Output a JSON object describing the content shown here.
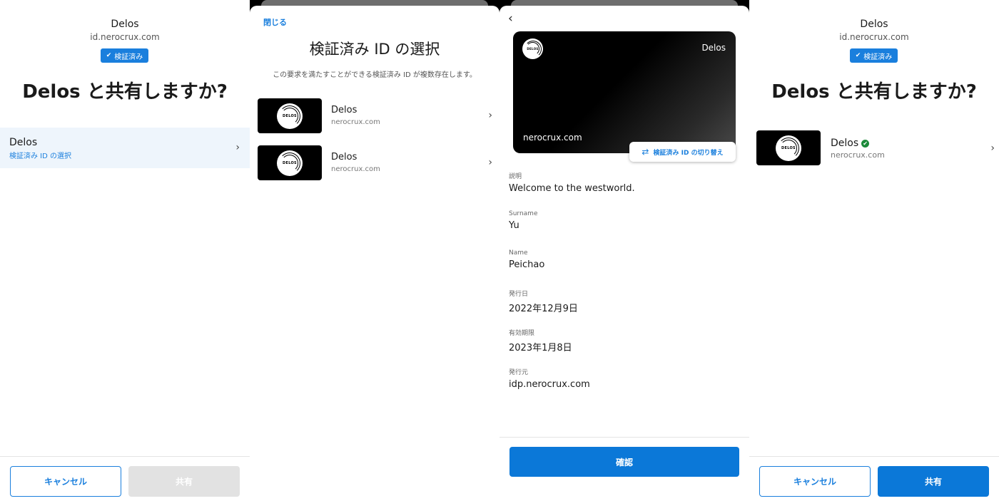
{
  "share_screen_1": {
    "rp_name": "Delos",
    "rp_domain": "id.nerocrux.com",
    "verified_badge": "検証済み",
    "title": "Delos と共有しますか?",
    "select_row": {
      "title": "Delos",
      "subtitle": "検証済み ID の選択"
    },
    "cancel_label": "キャンセル",
    "share_label": "共有",
    "share_enabled": false
  },
  "select_sheet": {
    "close_label": "閉じる",
    "title": "検証済み ID の選択",
    "subtitle": "この要求を満たすことができる検証済み ID が複数存在します。",
    "items": [
      {
        "name": "Delos",
        "domain": "nerocrux.com",
        "logo_text": "DELOS"
      },
      {
        "name": "Delos",
        "domain": "nerocrux.com",
        "logo_text": "DELOS"
      }
    ]
  },
  "detail_screen": {
    "card": {
      "name": "Delos",
      "domain": "nerocrux.com",
      "logo_text": "DELOS"
    },
    "switch_label": "検証済み ID の切り替え",
    "fields": [
      {
        "label": "説明",
        "value": "Welcome to the westworld."
      },
      {
        "label": "Surname",
        "value": "Yu"
      },
      {
        "label": "Name",
        "value": "Peichao"
      },
      {
        "label": "発行日",
        "value": "2022年12月9日"
      },
      {
        "label": "有効期限",
        "value": "2023年1月8日"
      },
      {
        "label": "発行元",
        "value": "idp.nerocrux.com"
      }
    ],
    "confirm_label": "確認"
  },
  "share_screen_2": {
    "rp_name": "Delos",
    "rp_domain": "id.nerocrux.com",
    "verified_badge": "検証済み",
    "title": "Delos と共有しますか?",
    "selected_item": {
      "name": "Delos",
      "domain": "nerocrux.com",
      "logo_text": "DELOS"
    },
    "cancel_label": "キャンセル",
    "share_label": "共有",
    "share_enabled": true
  },
  "colors": {
    "accent": "#1a7fdd",
    "primary_button": "#0b78d8",
    "disabled_button": "#e2e2e2",
    "selected_row_bg": "#eef5fc",
    "verified_green": "#1c8a3a"
  },
  "icons": {
    "chevron": "chevron-right-icon",
    "back": "chevron-left-icon",
    "check": "check-icon",
    "switch": "switch-arrows-icon"
  }
}
